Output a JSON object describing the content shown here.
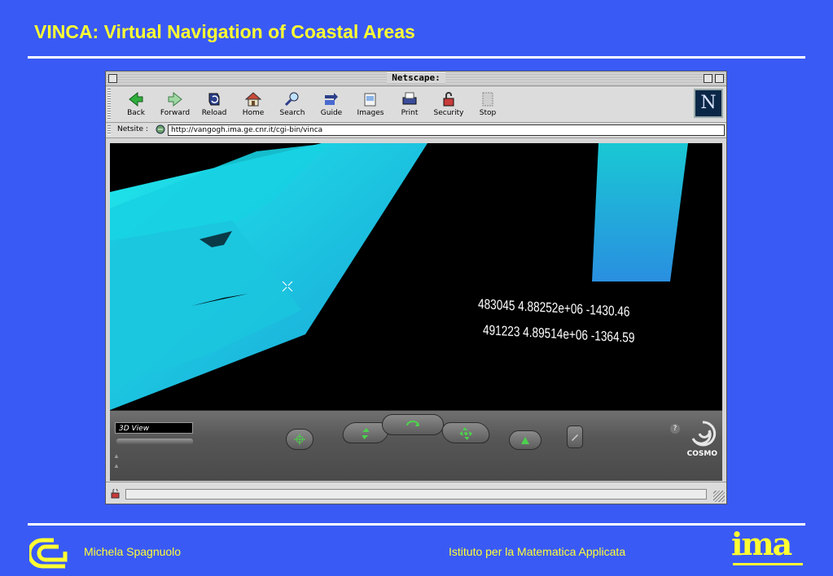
{
  "slide": {
    "title": "VINCA: Virtual Navigation of Coastal Areas",
    "author": "Michela Spagnuolo",
    "institute": "Istituto per la Matematica Applicata",
    "institute_logo_text": "ima"
  },
  "browser": {
    "window_title": "Netscape:",
    "toolbar": [
      {
        "label": "Back",
        "icon": "back-arrow-icon"
      },
      {
        "label": "Forward",
        "icon": "forward-arrow-icon"
      },
      {
        "label": "Reload",
        "icon": "reload-icon"
      },
      {
        "label": "Home",
        "icon": "home-icon"
      },
      {
        "label": "Search",
        "icon": "search-icon"
      },
      {
        "label": "Guide",
        "icon": "guide-icon"
      },
      {
        "label": "Images",
        "icon": "images-icon"
      },
      {
        "label": "Print",
        "icon": "print-icon"
      },
      {
        "label": "Security",
        "icon": "security-lock-icon"
      },
      {
        "label": "Stop",
        "icon": "stop-icon"
      }
    ],
    "brand_logo_text": "N",
    "location_label": "Netsite :",
    "url": "http://vangogh.ima.ge.cnr.it/cgi-bin/vinca"
  },
  "scene": {
    "coord_line_1": "483045 4.88252e+06 -1430.46",
    "coord_line_2": "491223 4.89514e+06 -1364.59"
  },
  "cosmo": {
    "view_name": "3D View",
    "brand": "COSMO",
    "help": "?"
  },
  "colors": {
    "slide_background": "#3a5af5",
    "title_yellow": "#ffff33",
    "terrain_cyan": "#1ad6e0"
  }
}
